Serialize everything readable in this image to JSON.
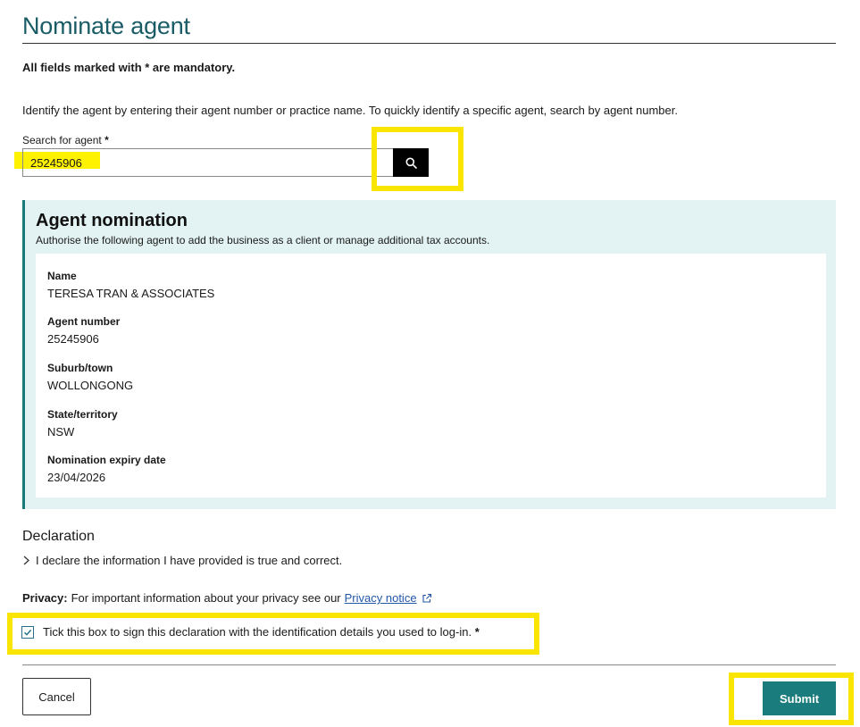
{
  "page": {
    "title": "Nominate agent",
    "mandatory_note": "All fields marked with * are mandatory.",
    "intro": "Identify the agent by entering their agent number or practice name. To quickly identify a specific agent, search by agent number."
  },
  "search": {
    "label": "Search for agent",
    "required_marker": "*",
    "value": "25245906",
    "button_icon": "search-icon"
  },
  "nomination": {
    "title": "Agent nomination",
    "subtitle": "Authorise the following agent to add the business as a client or manage additional tax accounts.",
    "fields": [
      {
        "label": "Name",
        "value": "TERESA TRAN & ASSOCIATES"
      },
      {
        "label": "Agent number",
        "value": "25245906"
      },
      {
        "label": "Suburb/town",
        "value": "WOLLONGONG"
      },
      {
        "label": "State/territory",
        "value": "NSW"
      },
      {
        "label": "Nomination expiry date",
        "value": "23/04/2026"
      }
    ]
  },
  "declaration": {
    "heading": "Declaration",
    "toggle_text": "I declare the information I have provided is true and correct."
  },
  "privacy": {
    "label": "Privacy:",
    "text": "For important information about your privacy see our",
    "link": "Privacy notice"
  },
  "tick": {
    "text": "Tick this box to sign this declaration with the identification details you used to log-in.",
    "required_marker": "*",
    "checked": true
  },
  "buttons": {
    "cancel": "Cancel",
    "submit": "Submit"
  },
  "colors": {
    "title": "#1a5c66",
    "panel_bg": "#e3f2f2",
    "panel_accent": "#1a7a7a",
    "submit_bg": "#1a7c7c",
    "annotation": "#f9e500",
    "highlight": "#fff200",
    "link": "#2257a8"
  }
}
